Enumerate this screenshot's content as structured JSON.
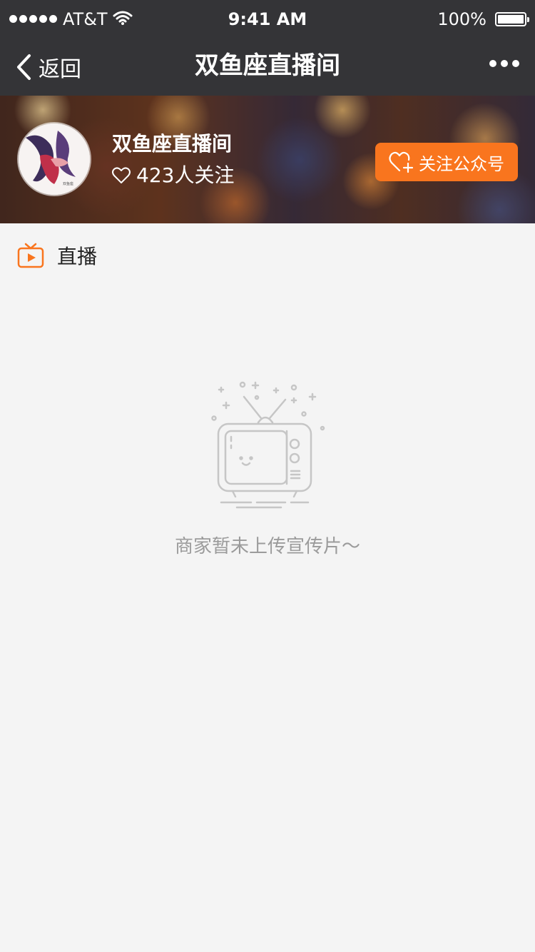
{
  "status_bar": {
    "carrier": "AT&T",
    "time": "9:41 AM",
    "battery": "100%"
  },
  "nav": {
    "back_label": "返回",
    "title": "双鱼座直播间"
  },
  "header": {
    "room_name": "双鱼座直播间",
    "followers": "423人关注",
    "follow_button": "关注公众号",
    "avatar_caption": "双鱼座"
  },
  "section": {
    "title": "直播"
  },
  "empty_state": {
    "message": "商家暂未上传宣传片～",
    "icon": "tv-icon"
  },
  "colors": {
    "accent": "#f9751e",
    "nav_bg": "#343437",
    "page_bg": "#f4f4f4",
    "muted_text": "#9b9b9b"
  }
}
